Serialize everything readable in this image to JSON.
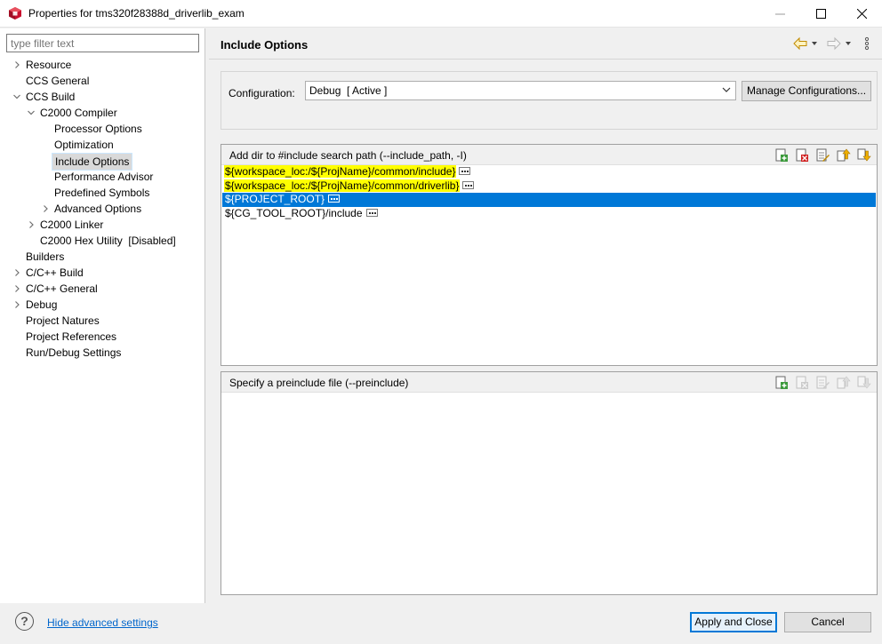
{
  "window": {
    "title": "Properties for tms320f28388d_driverlib_exam"
  },
  "sidebar": {
    "filter_placeholder": "type filter text",
    "tree": [
      {
        "label": "Resource",
        "level": 0,
        "expander": "collapsed"
      },
      {
        "label": "CCS General",
        "level": 0,
        "expander": "none"
      },
      {
        "label": "CCS Build",
        "level": 0,
        "expander": "expanded"
      },
      {
        "label": "C2000 Compiler",
        "level": 1,
        "expander": "expanded"
      },
      {
        "label": "Processor Options",
        "level": 2,
        "expander": "none"
      },
      {
        "label": "Optimization",
        "level": 2,
        "expander": "none"
      },
      {
        "label": "Include Options",
        "level": 2,
        "expander": "none",
        "selected": true
      },
      {
        "label": "Performance Advisor",
        "level": 2,
        "expander": "none"
      },
      {
        "label": "Predefined Symbols",
        "level": 2,
        "expander": "none"
      },
      {
        "label": "Advanced Options",
        "level": 2,
        "expander": "collapsed"
      },
      {
        "label": "C2000 Linker",
        "level": 1,
        "expander": "collapsed"
      },
      {
        "label": "C2000 Hex Utility  [Disabled]",
        "level": 1,
        "expander": "none"
      },
      {
        "label": "Builders",
        "level": 0,
        "expander": "none"
      },
      {
        "label": "C/C++ Build",
        "level": 0,
        "expander": "collapsed"
      },
      {
        "label": "C/C++ General",
        "level": 0,
        "expander": "collapsed"
      },
      {
        "label": "Debug",
        "level": 0,
        "expander": "collapsed"
      },
      {
        "label": "Project Natures",
        "level": 0,
        "expander": "none"
      },
      {
        "label": "Project References",
        "level": 0,
        "expander": "none"
      },
      {
        "label": "Run/Debug Settings",
        "level": 0,
        "expander": "none"
      }
    ]
  },
  "page": {
    "title": "Include Options",
    "configuration_label": "Configuration:",
    "configuration_value": "Debug  [ Active ]",
    "manage_button": "Manage Configurations..."
  },
  "include_paths": {
    "header": "Add dir to #include search path (--include_path, -I)",
    "items": [
      {
        "text": "${workspace_loc:/${ProjName}/common/include}",
        "highlight": true,
        "selected": false
      },
      {
        "text": "${workspace_loc:/${ProjName}/common/driverlib}",
        "highlight": true,
        "selected": false
      },
      {
        "text": "${PROJECT_ROOT}",
        "highlight": false,
        "selected": true
      },
      {
        "text": "${CG_TOOL_ROOT}/include",
        "highlight": false,
        "selected": false
      }
    ]
  },
  "preinclude": {
    "header": "Specify a preinclude file (--preinclude)",
    "items": []
  },
  "footer": {
    "advanced_link": "Hide advanced settings",
    "help_glyph": "?",
    "apply_close": "Apply and Close",
    "cancel": "Cancel"
  },
  "icons": {
    "app": "ccs-cube-icon",
    "nav_back": "back-arrow-icon",
    "nav_forward": "forward-arrow-icon",
    "view_menu": "view-menu-icon"
  },
  "colors": {
    "selection": "#0078d7",
    "highlight": "#ffff00",
    "link": "#0066cc"
  }
}
